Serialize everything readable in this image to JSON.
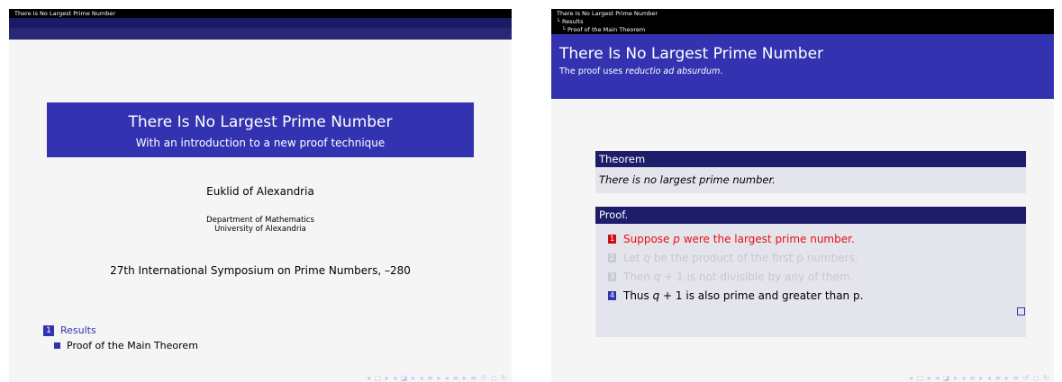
{
  "slide1": {
    "header_title": "There Is No Largest Prime Number",
    "title": "There Is No Largest Prime Number",
    "subtitle": "With an introduction to a new proof technique",
    "author": "Euklid of Alexandria",
    "institute_line1": "Department of Mathematics",
    "institute_line2": "University of Alexandria",
    "date": "27th International Symposium on Prime Numbers, –280",
    "toc": {
      "section_number": "1",
      "section": "Results",
      "subsection": "Proof of the Main Theorem"
    },
    "nav_symbols": "◂ □ ▸ ◂ ◪ ▸ ◂ ≡ ▸ ◂ ≡ ▸   ≡   ↺ ○ ↻"
  },
  "slide2": {
    "nav_title": "There Is No Largest Prime Number",
    "nav_section": "└ Results",
    "nav_subsection": "└ Proof of the Main Theorem",
    "frame_title": "There Is No Largest Prime Number",
    "frame_subtitle_prefix": "The proof uses ",
    "frame_subtitle_emph": "reductio ad absurdum",
    "frame_subtitle_suffix": ".",
    "theorem_title": "Theorem",
    "theorem_text": "There is no largest prime number.",
    "proof_title": "Proof.",
    "steps": [
      {
        "num": "1",
        "pre": "Suppose ",
        "var": "p",
        "post": " were the largest prime number.",
        "state": "current"
      },
      {
        "num": "2",
        "pre": "Let ",
        "var": "q",
        "post": " be the product of the first p numbers.",
        "state": "dim"
      },
      {
        "num": "3",
        "pre": "Then ",
        "var": "q",
        "post": " + 1 is not divisible by any of them.",
        "state": "dim"
      },
      {
        "num": "4",
        "pre": "Thus ",
        "var": "q",
        "post": " + 1 is also prime and greater than p.",
        "state": "normal"
      }
    ],
    "nav_symbols": "◂ □ ▸ ◂ ◪ ▸ ◂ ≡ ▸ ◂ ≡ ▸   ≡   ↺ ○ ↻"
  },
  "colors": {
    "beamer_blue": "#3333b2",
    "block_title": "#1d1d6b",
    "block_body": "#e4e4ec",
    "alert_red": "#e81010",
    "dim_text": "#c8c8cc"
  }
}
